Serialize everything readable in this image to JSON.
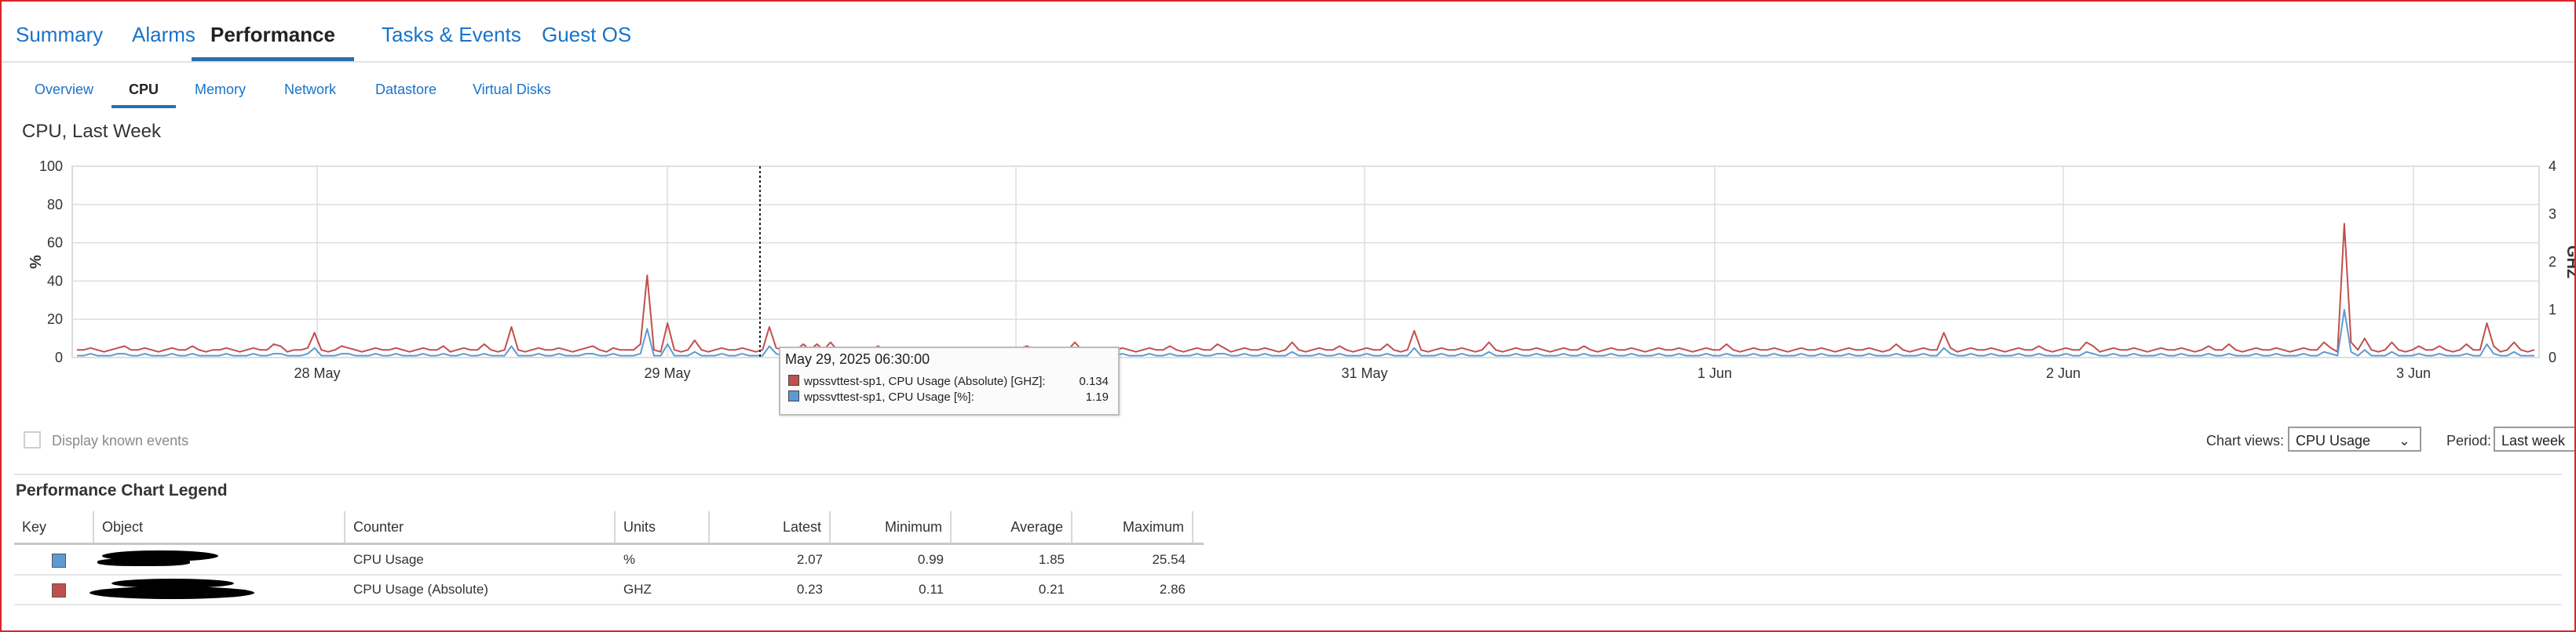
{
  "top_tabs": [
    {
      "label": "Summary",
      "active": false
    },
    {
      "label": "Alarms",
      "active": false
    },
    {
      "label": "Performance",
      "active": true
    },
    {
      "label": "Tasks & Events",
      "active": false
    },
    {
      "label": "Guest OS",
      "active": false
    }
  ],
  "sub_tabs": [
    {
      "label": "Overview",
      "active": false
    },
    {
      "label": "CPU",
      "active": true
    },
    {
      "label": "Memory",
      "active": false
    },
    {
      "label": "Network",
      "active": false
    },
    {
      "label": "Datastore",
      "active": false
    },
    {
      "label": "Virtual Disks",
      "active": false
    }
  ],
  "chart": {
    "title": "CPU, Last Week",
    "y_left_label": "%",
    "y_right_label": "GHZ",
    "y_left_ticks": [
      "0",
      "20",
      "40",
      "60",
      "80",
      "100"
    ],
    "y_right_ticks": [
      "0",
      "1",
      "2",
      "3",
      "4"
    ],
    "x_ticks": [
      "28 May",
      "29 May",
      "31 May",
      "1 Jun",
      "2 Jun",
      "3 Jun"
    ]
  },
  "chart_data": {
    "type": "line",
    "ylim": [
      0,
      100
    ],
    "ylim_right": [
      0,
      4
    ],
    "series": [
      {
        "name": "wpssvttest-sp1, CPU Usage (Absolute) [GHZ]",
        "color": "#c0504d",
        "values": [
          4,
          4,
          5,
          4,
          3,
          4,
          5,
          6,
          4,
          4,
          5,
          4,
          3,
          4,
          5,
          4,
          4,
          6,
          4,
          3,
          4,
          4,
          5,
          4,
          3,
          4,
          5,
          4,
          4,
          7,
          6,
          3,
          4,
          4,
          5,
          13,
          4,
          3,
          4,
          6,
          5,
          4,
          3,
          4,
          5,
          4,
          4,
          5,
          4,
          3,
          4,
          5,
          4,
          4,
          6,
          3,
          4,
          5,
          4,
          4,
          7,
          4,
          3,
          4,
          16,
          4,
          3,
          4,
          5,
          4,
          4,
          5,
          4,
          3,
          4,
          5,
          6,
          4,
          3,
          5,
          4,
          4,
          4,
          7,
          43,
          4,
          3,
          18,
          4,
          3,
          4,
          9,
          4,
          3,
          4,
          5,
          4,
          4,
          5,
          4,
          3,
          4,
          16,
          5,
          4,
          3,
          4,
          7,
          4,
          7,
          4,
          8,
          4,
          3,
          4,
          5,
          4,
          4,
          6,
          4,
          3,
          4,
          5,
          4,
          4,
          5,
          4,
          3,
          4,
          5,
          4,
          4,
          5,
          4,
          3,
          4,
          5,
          4,
          4,
          5,
          6,
          4,
          3,
          4,
          5,
          4,
          4,
          8,
          4,
          3,
          4,
          5,
          4,
          4,
          5,
          4,
          3,
          4,
          5,
          4,
          4,
          6,
          4,
          3,
          4,
          5,
          4,
          4,
          7,
          5,
          3,
          4,
          5,
          4,
          4,
          5,
          4,
          3,
          4,
          8,
          4,
          3,
          4,
          5,
          4,
          4,
          6,
          4,
          3,
          4,
          5,
          4,
          4,
          7,
          4,
          3,
          4,
          14,
          4,
          3,
          4,
          5,
          4,
          4,
          5,
          4,
          3,
          4,
          8,
          4,
          3,
          4,
          5,
          4,
          4,
          5,
          4,
          3,
          4,
          5,
          4,
          4,
          6,
          4,
          3,
          4,
          5,
          4,
          4,
          5,
          4,
          3,
          4,
          5,
          4,
          4,
          5,
          4,
          3,
          4,
          5,
          4,
          4,
          7,
          4,
          3,
          4,
          5,
          4,
          4,
          5,
          4,
          3,
          4,
          5,
          4,
          4,
          5,
          4,
          3,
          4,
          5,
          4,
          4,
          5,
          4,
          3,
          4,
          7,
          4,
          3,
          4,
          5,
          4,
          4,
          13,
          5,
          3,
          4,
          5,
          4,
          4,
          5,
          4,
          3,
          4,
          5,
          4,
          4,
          6,
          4,
          3,
          4,
          5,
          4,
          4,
          8,
          6,
          3,
          4,
          5,
          4,
          4,
          5,
          4,
          3,
          4,
          5,
          4,
          4,
          5,
          4,
          3,
          4,
          6,
          4,
          4,
          7,
          4,
          3,
          4,
          5,
          4,
          4,
          5,
          4,
          3,
          4,
          5,
          4,
          4,
          8,
          5,
          3,
          70,
          8,
          4,
          10,
          4,
          3,
          4,
          8,
          4,
          3,
          4,
          6,
          4,
          4,
          6,
          4,
          3,
          4,
          7,
          4,
          4,
          18,
          6,
          3,
          4,
          8,
          4,
          3,
          4
        ]
      },
      {
        "name": "wpssvttest-sp1, CPU Usage [%]",
        "color": "#5b9bd5",
        "values": [
          1,
          1,
          2,
          1,
          1,
          1,
          2,
          2,
          1,
          1,
          2,
          1,
          1,
          1,
          2,
          1,
          1,
          2,
          1,
          1,
          1,
          1,
          2,
          1,
          1,
          1,
          2,
          1,
          1,
          2,
          2,
          1,
          1,
          1,
          2,
          5,
          1,
          1,
          1,
          2,
          2,
          1,
          1,
          1,
          2,
          1,
          1,
          2,
          1,
          1,
          1,
          2,
          1,
          1,
          2,
          1,
          1,
          2,
          1,
          1,
          2,
          1,
          1,
          1,
          6,
          1,
          1,
          1,
          2,
          1,
          1,
          2,
          1,
          1,
          1,
          2,
          2,
          1,
          1,
          2,
          1,
          1,
          1,
          2,
          15,
          1,
          1,
          7,
          1,
          1,
          1,
          3,
          1,
          1,
          1,
          2,
          1,
          1,
          2,
          1,
          1,
          1,
          6,
          2,
          1,
          1,
          1,
          2,
          1,
          2,
          1,
          3,
          1,
          1,
          1,
          2,
          1,
          1,
          2,
          1,
          1,
          1,
          2,
          1,
          1,
          2,
          1,
          1,
          1,
          2,
          1,
          1,
          2,
          1,
          1,
          1,
          2,
          1,
          1,
          2,
          2,
          1,
          1,
          1,
          2,
          1,
          1,
          3,
          1,
          1,
          1,
          2,
          1,
          1,
          2,
          1,
          1,
          1,
          2,
          1,
          1,
          2,
          1,
          1,
          1,
          2,
          1,
          1,
          2,
          2,
          1,
          1,
          2,
          1,
          1,
          2,
          1,
          1,
          1,
          3,
          1,
          1,
          1,
          2,
          1,
          1,
          2,
          1,
          1,
          1,
          2,
          1,
          1,
          2,
          1,
          1,
          1,
          5,
          1,
          1,
          1,
          2,
          1,
          1,
          2,
          1,
          1,
          1,
          3,
          1,
          1,
          1,
          2,
          1,
          1,
          2,
          1,
          1,
          1,
          2,
          1,
          1,
          2,
          1,
          1,
          1,
          2,
          1,
          1,
          2,
          1,
          1,
          1,
          2,
          1,
          1,
          2,
          1,
          1,
          1,
          2,
          1,
          1,
          2,
          1,
          1,
          1,
          2,
          1,
          1,
          2,
          1,
          1,
          1,
          2,
          1,
          1,
          2,
          1,
          1,
          1,
          2,
          1,
          1,
          2,
          1,
          1,
          1,
          2,
          1,
          1,
          1,
          2,
          1,
          1,
          5,
          2,
          1,
          1,
          2,
          1,
          1,
          2,
          1,
          1,
          1,
          2,
          1,
          1,
          2,
          1,
          1,
          1,
          2,
          1,
          1,
          3,
          2,
          1,
          1,
          2,
          1,
          1,
          2,
          1,
          1,
          1,
          2,
          1,
          1,
          2,
          1,
          1,
          1,
          2,
          1,
          1,
          2,
          1,
          1,
          1,
          2,
          1,
          1,
          2,
          1,
          1,
          1,
          2,
          1,
          1,
          3,
          2,
          1,
          25,
          3,
          1,
          4,
          1,
          1,
          1,
          3,
          1,
          1,
          1,
          2,
          1,
          1,
          2,
          1,
          1,
          1,
          2,
          1,
          1,
          7,
          2,
          1,
          1,
          3,
          1,
          1,
          1
        ]
      }
    ]
  },
  "tooltip": {
    "timestamp": "May 29, 2025 06:30:00",
    "rows": [
      {
        "label": "wpssvttest-sp1, CPU Usage (Absolute) [GHZ]:",
        "value": "0.134",
        "color": "#c0504d"
      },
      {
        "label": "wpssvttest-sp1, CPU Usage [%]:",
        "value": "1.19",
        "color": "#5b9bd5"
      }
    ]
  },
  "known_events_label": "Display known events",
  "chart_views": {
    "label": "Chart views:",
    "value": "CPU Usage"
  },
  "period": {
    "label": "Period:",
    "value": "Last week"
  },
  "legend": {
    "title": "Performance Chart Legend",
    "headers": [
      "Key",
      "Object",
      "Counter",
      "Units",
      "Latest",
      "Minimum",
      "Average",
      "Maximum"
    ],
    "rows": [
      {
        "key_color": "#5b9bd5",
        "counter": "CPU Usage",
        "units": "%",
        "latest": "2.07",
        "minimum": "0.99",
        "average": "1.85",
        "maximum": "25.54"
      },
      {
        "key_color": "#c0504d",
        "counter": "CPU Usage (Absolute)",
        "units": "GHZ",
        "latest": "0.23",
        "minimum": "0.11",
        "average": "0.21",
        "maximum": "2.86"
      }
    ]
  },
  "colors": {
    "accent": "#1a73c8",
    "frame": "#d9262a",
    "series_red": "#c0504d",
    "series_blue": "#5b9bd5"
  }
}
